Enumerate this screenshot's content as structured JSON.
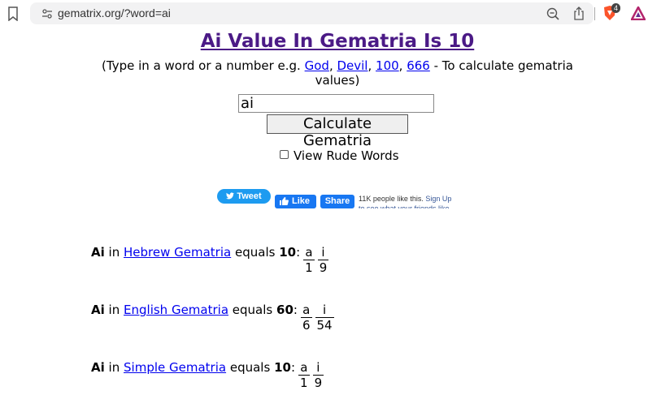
{
  "browser": {
    "url": "gematrix.org/?word=ai",
    "badge_count": "4"
  },
  "title": "Ai Value In Gematria Is 10",
  "subtitle": {
    "prefix": "(Type in a word or a number e.g. ",
    "links": [
      "God",
      "Devil",
      "100",
      "666"
    ],
    "suffix": " - To calculate gematria values)"
  },
  "form": {
    "input_value": "ai",
    "button_label": "Calculate Gematria",
    "rude_label": "View Rude Words",
    "rude_checked": false
  },
  "social": {
    "tweet": "Tweet",
    "like": "Like",
    "share": "Share",
    "fb_count": "11K people like this.",
    "fb_signup": "Sign Up to see what your friends like."
  },
  "results": [
    {
      "word": "Ai",
      "pre": "in",
      "system": "Hebrew Gematria",
      "mid": "equals",
      "value": "10",
      "letters": [
        {
          "l": "a",
          "v": "1"
        },
        {
          "l": "i",
          "v": "9"
        }
      ]
    },
    {
      "word": "Ai",
      "pre": "in",
      "system": "English Gematria",
      "mid": "equals",
      "value": "60",
      "letters": [
        {
          "l": "a",
          "v": "6"
        },
        {
          "l": "i",
          "v": "54"
        }
      ]
    },
    {
      "word": "Ai",
      "pre": "in",
      "system": "Simple Gematria",
      "mid": "equals",
      "value": "10",
      "letters": [
        {
          "l": "a",
          "v": "1"
        },
        {
          "l": "i",
          "v": "9"
        }
      ]
    }
  ]
}
